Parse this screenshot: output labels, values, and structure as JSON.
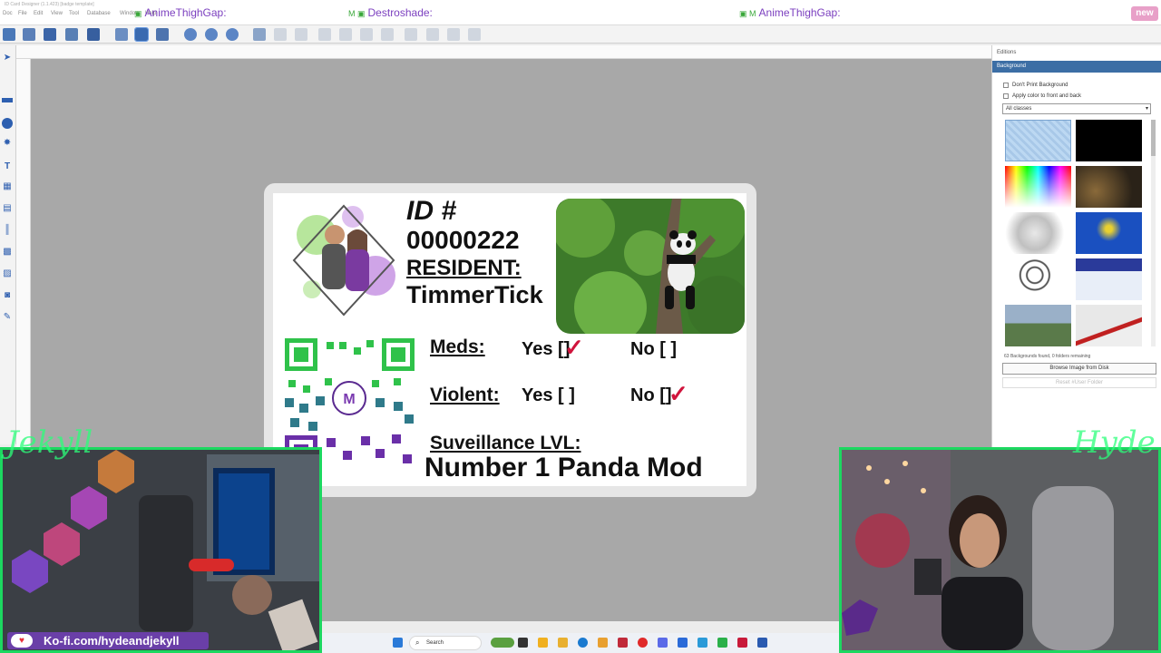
{
  "window": {
    "app_title": "ID Card Designer (1.1.423) [badge template]",
    "menus": [
      "Doc",
      "File",
      "Edit",
      "View",
      "Tool",
      "Database",
      "Window",
      "Help"
    ]
  },
  "overlay": {
    "left_title": "AnimeThighGap:",
    "center_title": "Destroshade:",
    "right_title": "AnimeThighGap:",
    "new_badge": "new",
    "left_signature": "Jekyll",
    "right_signature": "Hyde",
    "kofi": "Ko-fi.com/hydeandjekyll"
  },
  "card": {
    "id_label": "ID #",
    "id_number": "00000222",
    "resident_label": "RESIDENT:",
    "resident_name": "TimmerTick",
    "meds_label": "Meds:",
    "violent_label": "Violent:",
    "meds_yes": "Yes [",
    "meds_no": "No [  ]",
    "violent_yes": "Yes [  ]",
    "violent_no": "No [",
    "bracket_close": "]",
    "checkmark": "✓",
    "surveillance_label": "Suveillance LVL:",
    "surveillance_value": "Number 1 Panda Mod"
  },
  "panel": {
    "title": "Editions",
    "section": "Background",
    "checkbox_dont_print": "Don't Print Background",
    "checkbox_apply": "Apply color to front and back",
    "classes_select": "All classes",
    "bg_count": "63 Backgrounds found, 0 folders remaining",
    "browse_button": "Browse Image from Disk",
    "reset_button": "Reset #User Folder"
  },
  "taskbar": {
    "search": "Search"
  },
  "colors": {
    "accent_green": "#1cd860",
    "panel_header": "#3c6ea5",
    "check_red": "#d0143c"
  }
}
